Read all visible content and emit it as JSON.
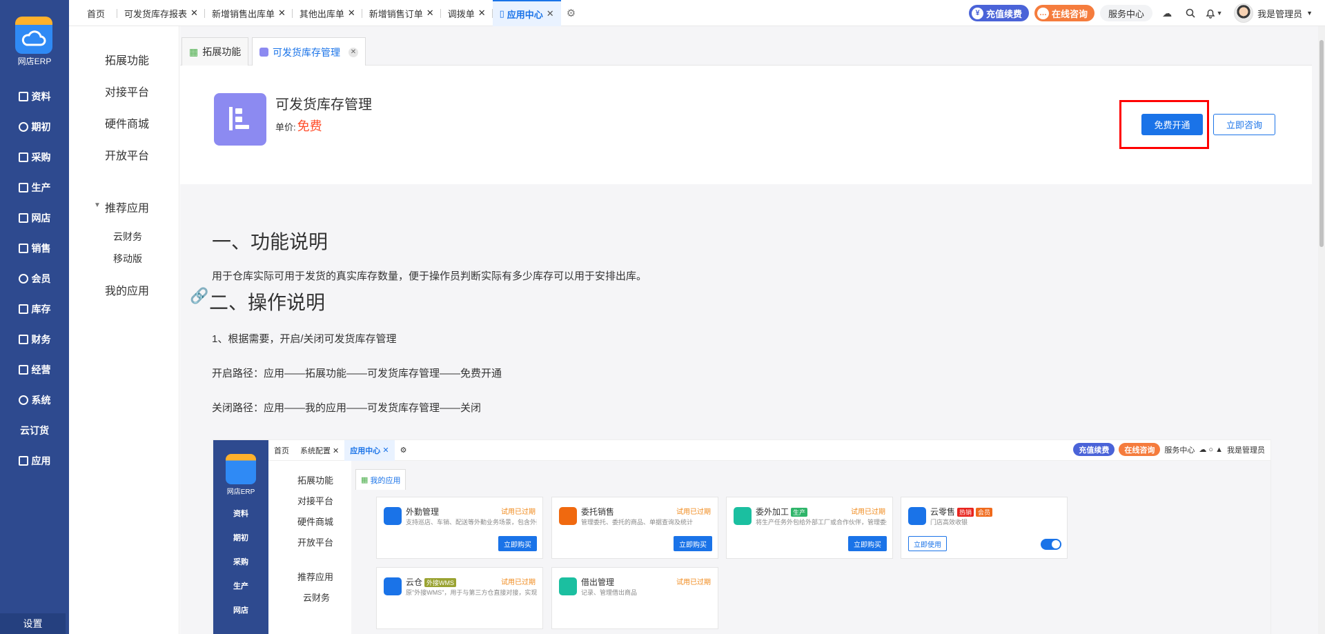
{
  "app": {
    "logo_text": "网店ERP",
    "settings_label": "设置"
  },
  "nav": [
    {
      "label": "资料",
      "icon": "document-icon"
    },
    {
      "label": "期初",
      "icon": "target-icon"
    },
    {
      "label": "采购",
      "icon": "chart-icon"
    },
    {
      "label": "生产",
      "icon": "factory-icon"
    },
    {
      "label": "网店",
      "icon": "store-icon"
    },
    {
      "label": "销售",
      "icon": "sales-icon"
    },
    {
      "label": "会员",
      "icon": "pie-icon"
    },
    {
      "label": "库存",
      "icon": "warehouse-icon"
    },
    {
      "label": "财务",
      "icon": "finance-icon"
    },
    {
      "label": "经营",
      "icon": "operation-icon"
    },
    {
      "label": "系统",
      "icon": "gear-icon"
    },
    {
      "label": "云订货",
      "icon": ""
    },
    {
      "label": "应用",
      "icon": "plus-icon"
    }
  ],
  "top_tabs": [
    {
      "label": "首页",
      "closable": false
    },
    {
      "label": "可发货库存报表",
      "closable": true
    },
    {
      "label": "新增销售出库单",
      "closable": true
    },
    {
      "label": "其他出库单",
      "closable": true
    },
    {
      "label": "新增销售订单",
      "closable": true
    },
    {
      "label": "调拨单",
      "closable": true
    },
    {
      "label": "应用中心",
      "closable": true,
      "active": true
    }
  ],
  "top_right": {
    "recharge": "充值续费",
    "consult": "在线咨询",
    "service": "服务中心",
    "user": "我是管理员"
  },
  "side2": {
    "items": [
      "拓展功能",
      "对接平台",
      "硬件商城",
      "开放平台"
    ],
    "group": "推荐应用",
    "sub": [
      "云财务",
      "移动版"
    ],
    "my_apps": "我的应用"
  },
  "content_tabs": [
    {
      "label": "拓展功能"
    },
    {
      "label": "可发货库存管理",
      "active": true
    }
  ],
  "product": {
    "title": "可发货库存管理",
    "price_label": "单价:",
    "price": "免费",
    "open_btn": "免费开通",
    "consult_btn": "立即咨询",
    "icon_color": "#8c8af1"
  },
  "doc": {
    "h1": "一、功能说明",
    "p1": "用于仓库实际可用于发货的真实库存数量，便于操作员判断实际有多少库存可以用于安排出库。",
    "h2": "二、操作说明",
    "p2": "1、根据需要，开启/关闭可发货库存管理",
    "p3": "开启路径：应用——拓展功能——可发货库存管理——免费开通",
    "p4": "关闭路径：应用——我的应用——可发货库存管理——关闭"
  },
  "inner": {
    "logo_text": "网店ERP",
    "nav": [
      "资料",
      "期初",
      "采购",
      "生产",
      "网店"
    ],
    "tabs": [
      "首页",
      "系统配置",
      "应用中心"
    ],
    "right": {
      "recharge": "充值续费",
      "consult": "在线咨询",
      "service": "服务中心",
      "user": "我是管理员"
    },
    "side": [
      "拓展功能",
      "对接平台",
      "硬件商城",
      "开放平台",
      "推荐应用",
      "云财务"
    ],
    "ctab": "我的应用",
    "cards": [
      {
        "title": "外勤管理",
        "status": "试用已过期",
        "desc": "支持巡店、车销、配送等外勤业务场景，包含外勤计...",
        "btn": "立即购买",
        "color": "#1a73e8"
      },
      {
        "title": "委托销售",
        "status": "试用已过期",
        "desc": "管理委托、委托的商品、单据查询及统计",
        "btn": "立即购买",
        "color": "#f0690f"
      },
      {
        "title": "委外加工",
        "badge": "生产",
        "badge_color": "#2fb56a",
        "status": "试用已过期",
        "desc": "将生产任务外包给外部工厂或合作伙伴，管理委外商...",
        "btn": "立即购买",
        "color": "#1bbfa0"
      },
      {
        "title": "云零售",
        "badge": "热销",
        "badge_color": "#e8251f",
        "badge2": "会员",
        "badge2_color": "#f06a1c",
        "status": "",
        "desc": "门店高效收银",
        "btn": "立即使用",
        "color": "#1a73e8"
      },
      {
        "title": "云仓",
        "badge": "外接WMS",
        "badge_color": "#9aa332",
        "status": "试用已过期",
        "desc": "原\"外接WMS\"，用于与第三方仓直接对接，实现出入...",
        "btn": "",
        "color": "#1a73e8"
      },
      {
        "title": "借出管理",
        "status": "试用已过期",
        "desc": "记录、管理借出商品",
        "btn": "",
        "color": "#1bbfa0"
      }
    ]
  }
}
